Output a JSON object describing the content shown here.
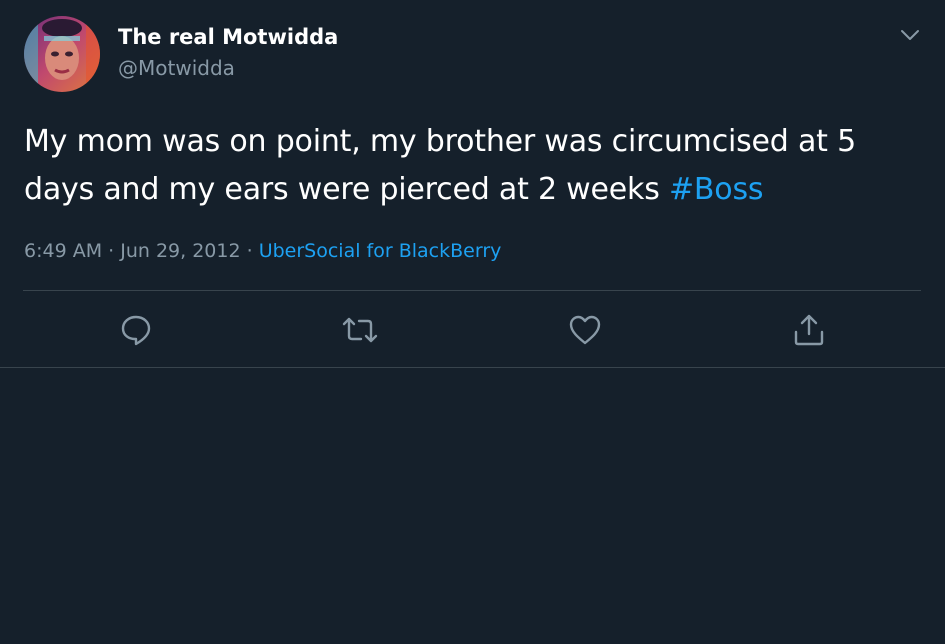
{
  "author": {
    "display_name": "The real Motwidda",
    "handle": "@Motwidda"
  },
  "tweet": {
    "text": "My mom was on point, my brother was circumcised at 5 days and my ears were pierced at 2 weeks ",
    "hashtag": "#Boss"
  },
  "meta": {
    "time": "6:49 AM",
    "separator1": " · ",
    "date": "Jun 29, 2012",
    "separator2": " · ",
    "source": "UberSocial for BlackBerry"
  },
  "icons": {
    "menu": "chevron-down-icon",
    "reply": "reply-icon",
    "retweet": "retweet-icon",
    "like": "heart-icon",
    "share": "share-icon"
  },
  "colors": {
    "background": "#15202b",
    "primary_text": "#ffffff",
    "secondary_text": "#8899a6",
    "accent": "#1da1f2",
    "border": "#38444d"
  }
}
